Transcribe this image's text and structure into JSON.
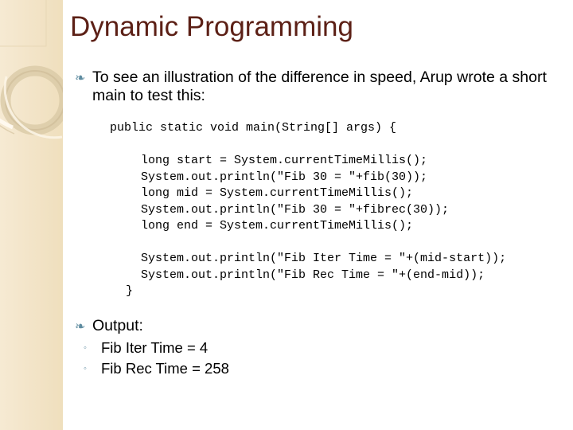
{
  "slide": {
    "title": "Dynamic Programming",
    "title_color": "#5c2016",
    "background_color": "#ffffff",
    "band_color": "#f2e3c6",
    "bullet_color": "#5f8ca0"
  },
  "bullets": {
    "intro": {
      "glyph": "❧",
      "icon_name": "swirl-bullet-icon",
      "text": "To see an illustration of the difference in speed,  Arup wrote a short main to test this:"
    },
    "output": {
      "glyph": "❧",
      "icon_name": "swirl-bullet-icon",
      "text": "Output:"
    }
  },
  "code": {
    "signature": "public static void main(String[] args) {",
    "body": [
      "long start = System.currentTimeMillis();",
      "System.out.println(\"Fib 30 = \"+fib(30));",
      "long mid = System.currentTimeMillis();",
      "System.out.println(\"Fib 30 = \"+fibrec(30));",
      "long end = System.currentTimeMillis();",
      "",
      "System.out.println(\"Fib Iter Time = \"+(mid-start));",
      "System.out.println(\"Fib Rec Time = \"+(end-mid));"
    ],
    "closing_brace": "}"
  },
  "output_results": {
    "glyph": "◦",
    "items": [
      {
        "label": "Fib Iter Time = 4"
      },
      {
        "label": "Fib Rec Time = 258"
      }
    ]
  }
}
